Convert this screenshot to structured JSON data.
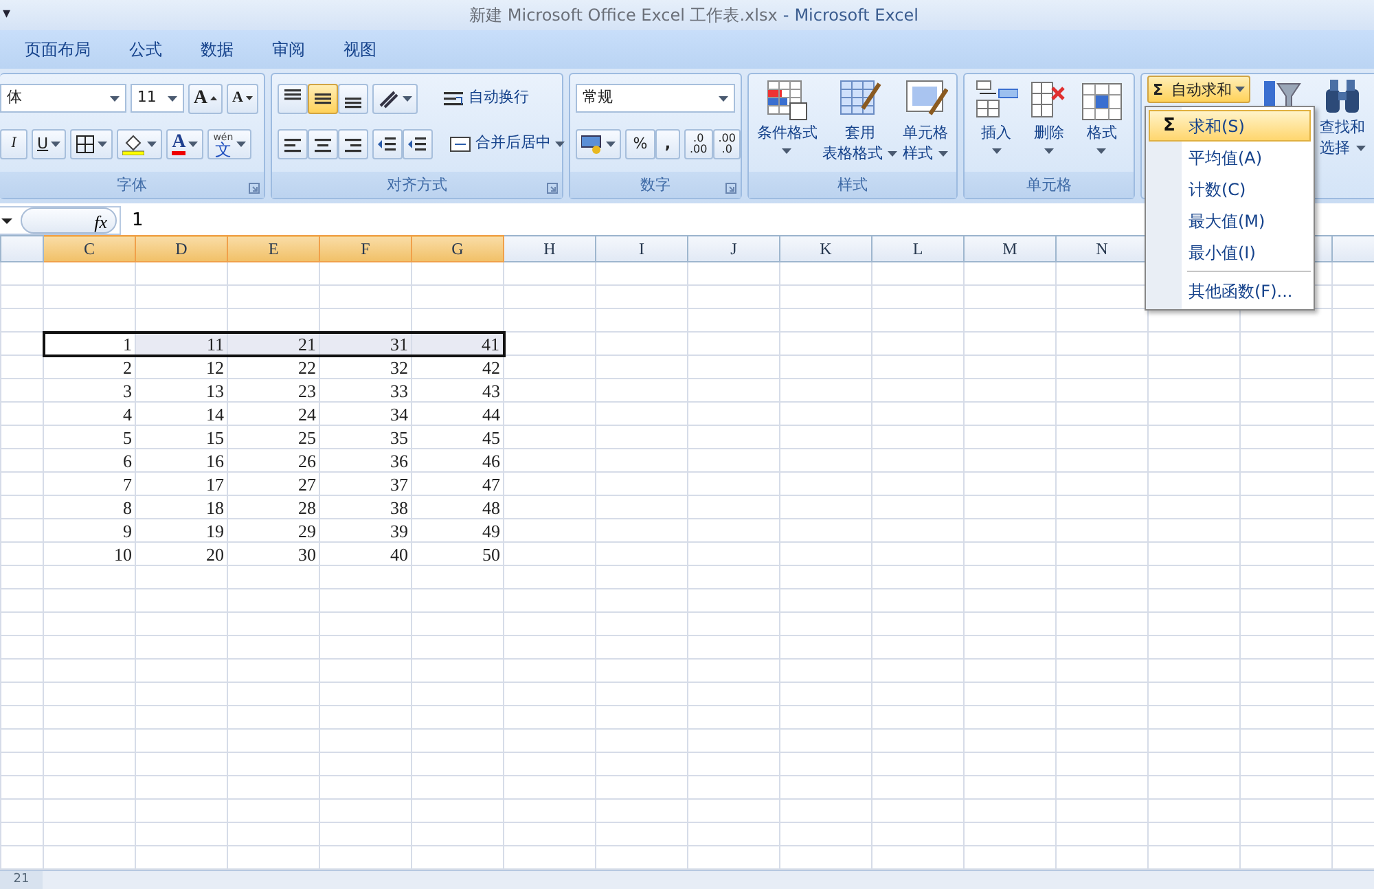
{
  "quick_access": {
    "caret": "▾"
  },
  "window": {
    "document_title": "新建 Microsoft Office Excel 工作表.xlsx",
    "separator": "-",
    "app_name": "Microsoft Excel"
  },
  "tabs": [
    {
      "label": "页面布局"
    },
    {
      "label": "公式"
    },
    {
      "label": "数据"
    },
    {
      "label": "审阅"
    },
    {
      "label": "视图"
    }
  ],
  "ribbon": {
    "groups": [
      {
        "kind": "font",
        "label": "字体",
        "font_name": "体",
        "font_size": "11",
        "size_buttons": [
          {
            "kind": "grow",
            "label": "A"
          },
          {
            "kind": "shrink",
            "label": "A"
          }
        ],
        "italic": "I",
        "underline": "U",
        "font_color": "A",
        "phonetic": [
          "wén",
          "文"
        ],
        "launcher": true
      },
      {
        "kind": "alignment",
        "label": "对齐方式",
        "vertical": [
          {
            "kind": "top",
            "selected": false
          },
          {
            "kind": "middle",
            "selected": true
          },
          {
            "kind": "bottom",
            "selected": false
          }
        ],
        "horizontal": [
          {
            "kind": "left",
            "selected": false
          },
          {
            "kind": "center",
            "selected": false
          },
          {
            "kind": "right",
            "selected": false
          }
        ],
        "wrap_text": "自动换行",
        "merge_center": "合并后居中",
        "launcher": true
      },
      {
        "kind": "number",
        "label": "数字",
        "format": "常规",
        "percent": "%",
        "comma": ",",
        "increase_decimal": [
          ".0",
          ".00"
        ],
        "decrease_decimal": [
          ".00",
          ".0"
        ],
        "launcher": true
      },
      {
        "kind": "big",
        "label": "样式",
        "buttons": [
          {
            "kind": "conditional",
            "lines": [
              "条件格式"
            ]
          },
          {
            "kind": "table",
            "lines": [
              "套用",
              "表格格式"
            ]
          },
          {
            "kind": "cellstyle",
            "lines": [
              "单元格",
              "样式"
            ]
          }
        ]
      },
      {
        "kind": "big",
        "label": "单元格",
        "buttons": [
          {
            "kind": "insert",
            "lines": [
              "插入"
            ]
          },
          {
            "kind": "delete",
            "lines": [
              "删除"
            ]
          },
          {
            "kind": "format",
            "lines": [
              "格式"
            ]
          }
        ]
      },
      {
        "kind": "editing",
        "autosum": {
          "symbol": "Σ",
          "label": "自动求和",
          "expanded": true
        },
        "find": [
          "查找和",
          "选择"
        ]
      }
    ]
  },
  "autosum_menu": {
    "items": [
      {
        "icon": "Σ",
        "label": "求和(S)",
        "selected": true
      },
      {
        "label": "平均值(A)",
        "selected": false
      },
      {
        "label": "计数(C)",
        "selected": false
      },
      {
        "label": "最大值(M)",
        "selected": false
      },
      {
        "label": "最小值(I)",
        "selected": false
      },
      {
        "label": "其他函数(F)...",
        "selected": false,
        "separator_before": true
      }
    ]
  },
  "formula_bar": {
    "fx": "fx",
    "value": "1"
  },
  "sheet": {
    "columns": [
      {
        "label": "C",
        "selected": true
      },
      {
        "label": "D",
        "selected": true
      },
      {
        "label": "E",
        "selected": true
      },
      {
        "label": "F",
        "selected": true
      },
      {
        "label": "G",
        "selected": true
      },
      {
        "label": "H",
        "selected": false
      },
      {
        "label": "I",
        "selected": false
      },
      {
        "label": "J",
        "selected": false
      },
      {
        "label": "K",
        "selected": false
      },
      {
        "label": "L",
        "selected": false
      },
      {
        "label": "M",
        "selected": false
      },
      {
        "label": "N",
        "selected": false
      }
    ],
    "rows": [
      {
        "cells": [
          "1",
          "11",
          "21",
          "31",
          "41"
        ],
        "selected": true
      },
      {
        "cells": [
          "2",
          "12",
          "22",
          "32",
          "42"
        ],
        "selected": false
      },
      {
        "cells": [
          "3",
          "13",
          "23",
          "33",
          "43"
        ],
        "selected": false
      },
      {
        "cells": [
          "4",
          "14",
          "24",
          "34",
          "44"
        ],
        "selected": false
      },
      {
        "cells": [
          "5",
          "15",
          "25",
          "35",
          "45"
        ],
        "selected": false
      },
      {
        "cells": [
          "6",
          "16",
          "26",
          "36",
          "46"
        ],
        "selected": false
      },
      {
        "cells": [
          "7",
          "17",
          "27",
          "37",
          "47"
        ],
        "selected": false
      },
      {
        "cells": [
          "8",
          "18",
          "28",
          "38",
          "48"
        ],
        "selected": false
      },
      {
        "cells": [
          "9",
          "19",
          "29",
          "39",
          "49"
        ],
        "selected": false
      },
      {
        "cells": [
          "10",
          "20",
          "30",
          "40",
          "50"
        ],
        "selected": false
      }
    ]
  },
  "bottom_fragment": "21"
}
